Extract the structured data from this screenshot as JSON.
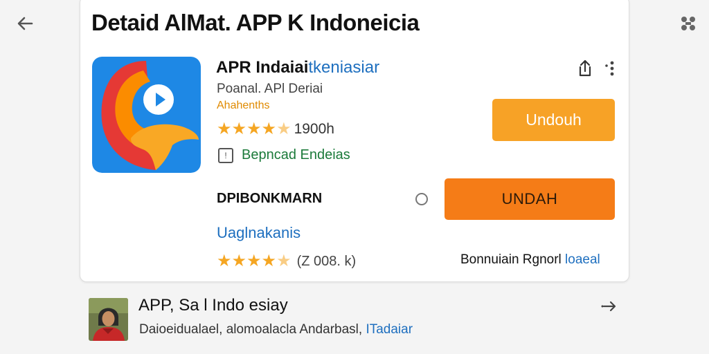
{
  "header": {
    "back_icon": "arrow-left-icon",
    "title": "Detaid AlMat. APP K Indoneicia",
    "grid_icon": "puzzle-icon"
  },
  "app": {
    "name_main": "APR Indaiai",
    "name_accent": "tkeniasiar",
    "developer": "Poanal. APl Deriai",
    "category": "Ahahenths",
    "rating": 4.5,
    "rating_text": "1900h",
    "badge_text": "Bepncad Endeias",
    "share_icon": "share-icon",
    "more_icon": "more-vert-icon",
    "install_label": "Undouh"
  },
  "section": {
    "label": "DPIBONKMARN",
    "primary_button": "UNDAH",
    "link": "Uaglnakanis",
    "rating": 4.5,
    "rating_text": "(Z 008. k)",
    "note_main": "Bonnuiain Rgnorl",
    "note_accent": "loaeal"
  },
  "related": {
    "title": "APP, Sa l Indo esiay",
    "sub_main": "Daioeidualael, alomoalacla Andarbasl,",
    "sub_accent": "ITadaiar",
    "arrow_icon": "arrow-right-icon"
  },
  "colors": {
    "accent_orange": "#f7a226",
    "primary_orange": "#f57c17",
    "link_blue": "#1e6fbf",
    "badge_green": "#1b7a3a"
  }
}
